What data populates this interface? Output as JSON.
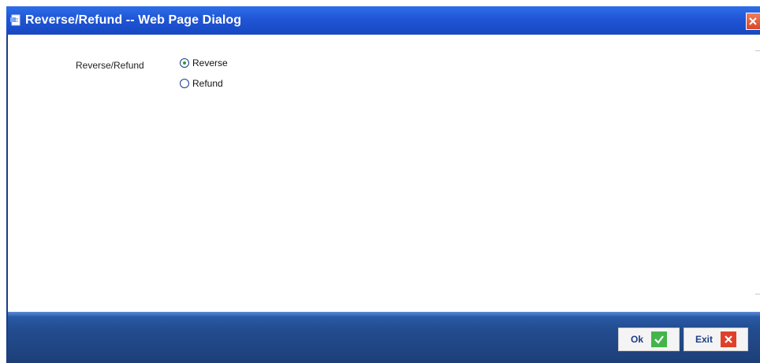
{
  "window": {
    "title": "Reverse/Refund -- Web Page Dialog"
  },
  "form": {
    "field_label": "Reverse/Refund",
    "options": [
      {
        "label": "Reverse",
        "selected": true
      },
      {
        "label": "Refund",
        "selected": false
      }
    ]
  },
  "footer": {
    "ok_label": "Ok",
    "exit_label": "Exit"
  },
  "colors": {
    "titlebar": "#1f55d6",
    "footer": "#234c8f",
    "ok_icon": "#43b54a",
    "exit_icon": "#e0402a"
  }
}
